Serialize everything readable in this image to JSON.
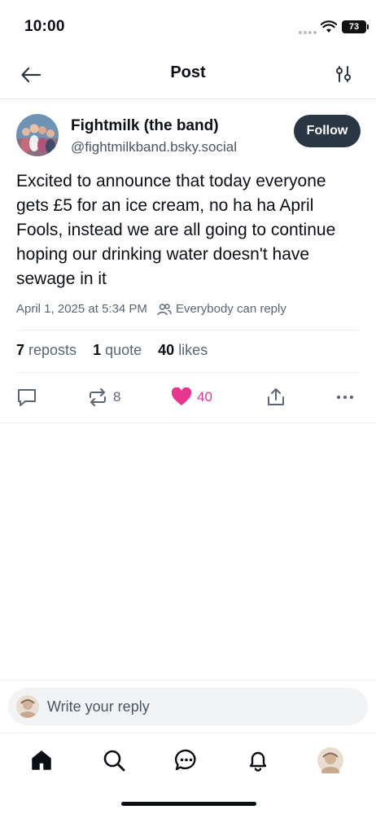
{
  "status_bar": {
    "time": "10:00",
    "battery": "73"
  },
  "header": {
    "title": "Post"
  },
  "post": {
    "author_name": "Fightmilk (the band)",
    "author_handle": "@fightmilkband.bsky.social",
    "follow_label": "Follow",
    "text": "Excited to announce that today everyone gets £5 for an ice cream, no ha ha April Fools, instead we are all going to continue hoping our drinking water doesn't have sewage in it",
    "date": "April 1, 2025 at 5:34 PM",
    "reply_permission": "Everybody can reply",
    "stats": {
      "reposts_count": "7",
      "reposts_label": "reposts",
      "quotes_count": "1",
      "quotes_label": "quote",
      "likes_count": "40",
      "likes_label": "likes"
    },
    "actions": {
      "repost_count": "8",
      "like_count": "40"
    }
  },
  "reply_bar": {
    "placeholder": "Write your reply"
  },
  "tabbar": {
    "items": [
      "home-icon",
      "search-icon",
      "chat-icon",
      "bell-icon",
      "profile-avatar"
    ]
  },
  "colors": {
    "accent": "#e8368f",
    "follow_bg": "#2a3644",
    "muted": "#5b6573"
  }
}
